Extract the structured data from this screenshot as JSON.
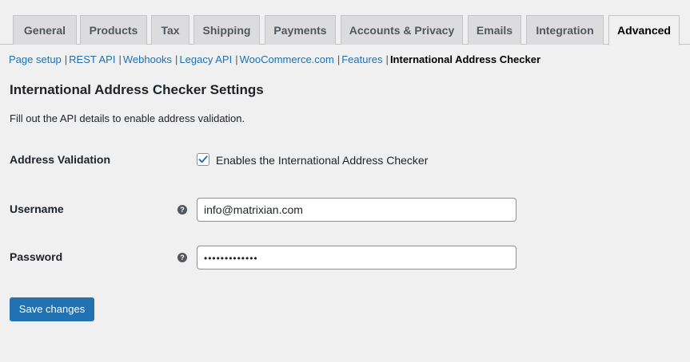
{
  "tabs": [
    {
      "label": "General",
      "active": false
    },
    {
      "label": "Products",
      "active": false
    },
    {
      "label": "Tax",
      "active": false
    },
    {
      "label": "Shipping",
      "active": false
    },
    {
      "label": "Payments",
      "active": false
    },
    {
      "label": "Accounts & Privacy",
      "active": false
    },
    {
      "label": "Emails",
      "active": false
    },
    {
      "label": "Integration",
      "active": false
    },
    {
      "label": "Advanced",
      "active": true
    }
  ],
  "subnav": {
    "items": [
      "Page setup",
      "REST API",
      "Webhooks",
      "Legacy API",
      "WooCommerce.com",
      "Features"
    ],
    "current": "International Address Checker",
    "separator": "|"
  },
  "settings": {
    "title": "International Address Checker Settings",
    "description": "Fill out the API details to enable address validation.",
    "address_validation": {
      "label": "Address Validation",
      "checkbox_label": "Enables the International Address Checker",
      "checked": true
    },
    "username": {
      "label": "Username",
      "value": "info@matrixian.com",
      "help_glyph": "?"
    },
    "password": {
      "label": "Password",
      "value": "•••••••••••••",
      "help_glyph": "?"
    }
  },
  "save_button": {
    "label": "Save changes"
  },
  "colors": {
    "background": "#f0f0f1",
    "accent": "#2271b1",
    "tab_inactive": "#dcdcde",
    "text": "#1d2327"
  }
}
